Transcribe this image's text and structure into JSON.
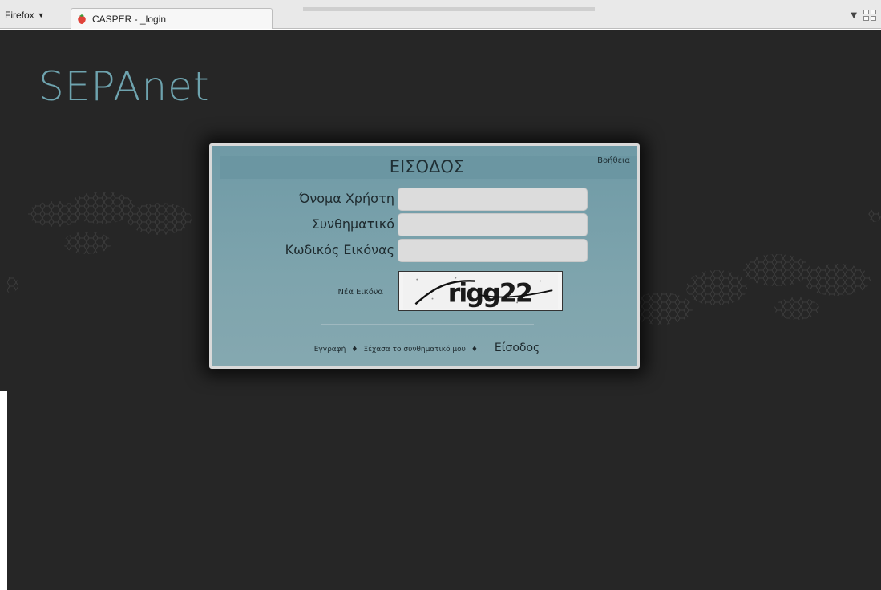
{
  "browser": {
    "menu_label": "Firefox",
    "tab_title": "CASPER - _login"
  },
  "page": {
    "logo": "SEPAnet",
    "login": {
      "title": "ΕΙΣΟΔΟΣ",
      "help_link": "Βοήθεια",
      "username_label": "Όνομα Χρήστη",
      "username_value": "",
      "password_label": "Συνθηματικό",
      "password_value": "",
      "captcha_label": "Κωδικός Εικόνας",
      "captcha_value": "",
      "new_image_link": "Νέα Εικόνα",
      "captcha_text": "rigg22",
      "register_link": "Εγγραφή",
      "separator": "♦",
      "forgot_link": "Ξέχασα το συνθηματικό μου",
      "submit_link": "Είσοδος"
    }
  },
  "colors": {
    "background": "#262626",
    "logo": "#6ea3ae",
    "panel": "#7ea4ad"
  }
}
